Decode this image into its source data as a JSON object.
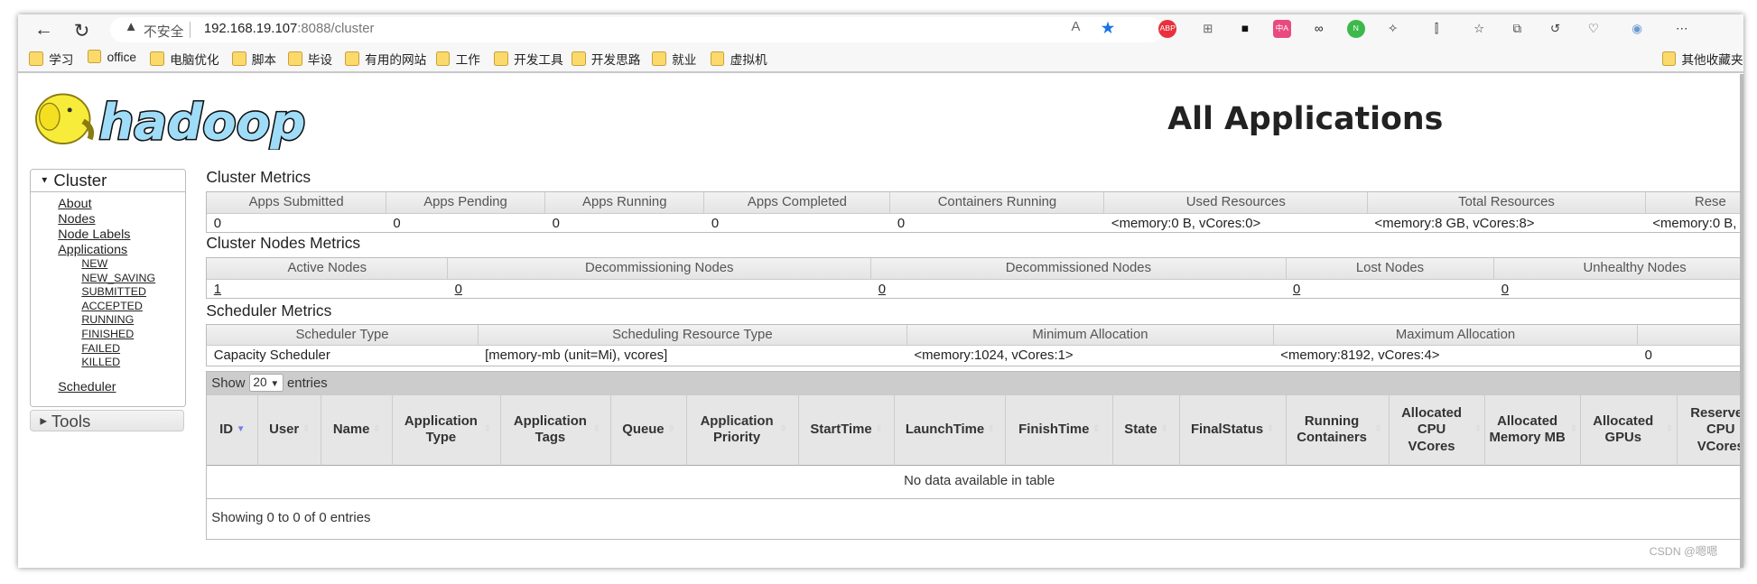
{
  "browser": {
    "security_label": "不安全",
    "url_host": "192.168.19.107",
    "url_rest": ":8088/cluster",
    "extensions": [
      "ABP",
      "⊞",
      "■",
      "中A",
      "∞",
      "N",
      "✧",
      "⫿",
      "☆",
      "⧉",
      "↺",
      "♡",
      "◉",
      "⋯"
    ],
    "bookmarks": [
      "学习",
      "office",
      "电脑优化",
      "脚本",
      "毕设",
      "有用的网站",
      "工作",
      "开发工具",
      "开发思路",
      "就业",
      "虚拟机"
    ],
    "other_bookmarks": "其他收藏夹"
  },
  "header": {
    "logo": "hadoop",
    "title": "All Applications"
  },
  "sidebar": {
    "cluster_label": "Cluster",
    "links": [
      "About",
      "Nodes",
      "Node Labels",
      "Applications"
    ],
    "app_states": [
      "NEW",
      "NEW_SAVING",
      "SUBMITTED",
      "ACCEPTED",
      "RUNNING",
      "FINISHED",
      "FAILED",
      "KILLED"
    ],
    "scheduler": "Scheduler",
    "tools_label": "Tools"
  },
  "cluster_metrics": {
    "title": "Cluster Metrics",
    "headers": [
      "Apps Submitted",
      "Apps Pending",
      "Apps Running",
      "Apps Completed",
      "Containers Running",
      "Used Resources",
      "Total Resources",
      "Rese"
    ],
    "values": [
      "0",
      "0",
      "0",
      "0",
      "0",
      "<memory:0 B, vCores:0>",
      "<memory:8 GB, vCores:8>",
      "<memory:0 B,"
    ]
  },
  "nodes_metrics": {
    "title": "Cluster Nodes Metrics",
    "headers": [
      "Active Nodes",
      "Decommissioning Nodes",
      "Decommissioned Nodes",
      "Lost Nodes",
      "Unhealthy Nodes"
    ],
    "values": [
      "1",
      "0",
      "0",
      "0",
      "0"
    ]
  },
  "scheduler_metrics": {
    "title": "Scheduler Metrics",
    "headers": [
      "Scheduler Type",
      "Scheduling Resource Type",
      "Minimum Allocation",
      "Maximum Allocation",
      ""
    ],
    "values": [
      "Capacity Scheduler",
      "[memory-mb (unit=Mi), vcores]",
      "<memory:1024, vCores:1>",
      "<memory:8192, vCores:4>",
      "0"
    ]
  },
  "apps_table": {
    "show": "Show",
    "page_size": "20",
    "entries": "entries",
    "columns": [
      "ID",
      "User",
      "Name",
      "Application Type",
      "Application Tags",
      "Queue",
      "Application Priority",
      "StartTime",
      "LaunchTime",
      "FinishTime",
      "State",
      "FinalStatus",
      "Running Containers",
      "Allocated CPU VCores",
      "Allocated Memory MB",
      "Allocated GPUs",
      "Reserved CPU VCores"
    ],
    "empty": "No data available in table",
    "info": "Showing 0 to 0 of 0 entries"
  },
  "watermark": "CSDN @嗯嗯"
}
